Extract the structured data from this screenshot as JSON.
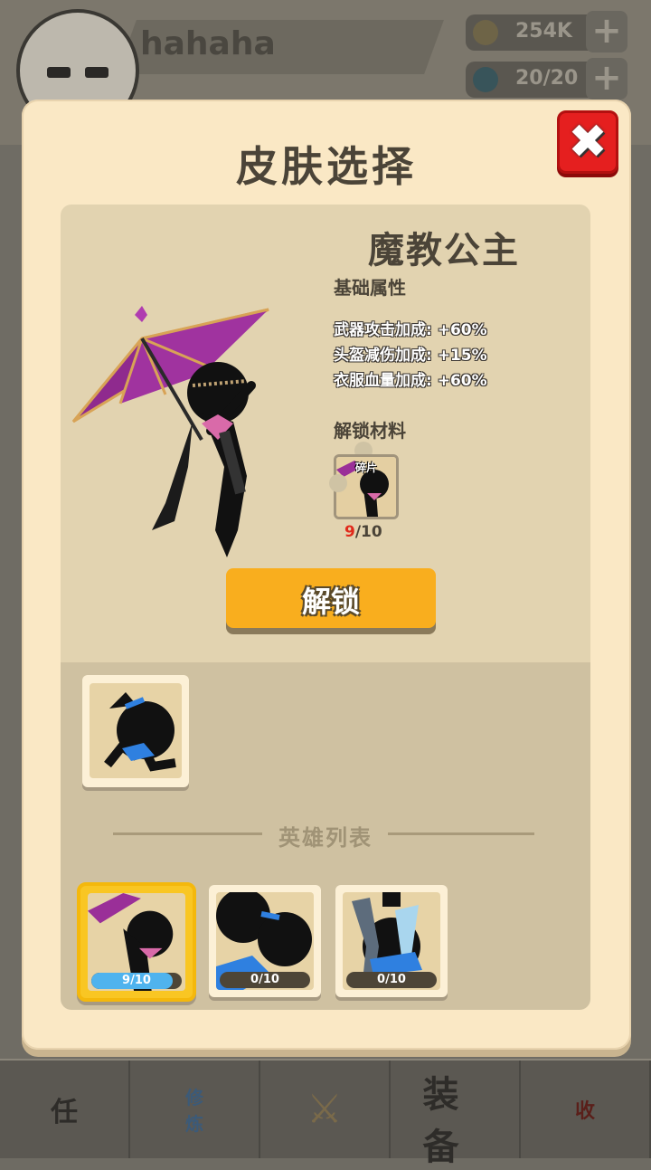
{
  "background": {
    "player_name": "hahaha",
    "gold": "254K",
    "energy": "20/20",
    "plus": "+",
    "nav": [
      {
        "label": "任"
      },
      {
        "label": "修\n炼"
      },
      {
        "label": "⚔"
      },
      {
        "label": "装备"
      },
      {
        "label": "收"
      }
    ]
  },
  "modal": {
    "title": "皮肤选择",
    "close": "✖",
    "detail": {
      "skin_name": "魔教公主",
      "base_attr_label": "基础属性",
      "attrs": [
        "武器攻击加成: +60%",
        "头盔减伤加成: +15%",
        "衣服血量加成: +60%"
      ],
      "unlock_material_label": "解锁材料",
      "material": {
        "label": "碎片",
        "current": "9",
        "total": "/10"
      },
      "unlock_button": "解锁"
    },
    "list": {
      "divider": "英雄列表",
      "heroes": [
        {
          "progress": "9/10",
          "fraction": 0.9,
          "selected": true
        },
        {
          "progress": "0/10",
          "fraction": 0.0,
          "selected": false
        },
        {
          "progress": "0/10",
          "fraction": 0.0,
          "selected": false
        }
      ]
    }
  },
  "colors": {
    "modal_bg": "#fae8c5",
    "accent_button": "#f9ae1e",
    "close_red": "#e51f1f",
    "progress_blue": "#4fb3ee",
    "count_red": "#e02a1b"
  }
}
